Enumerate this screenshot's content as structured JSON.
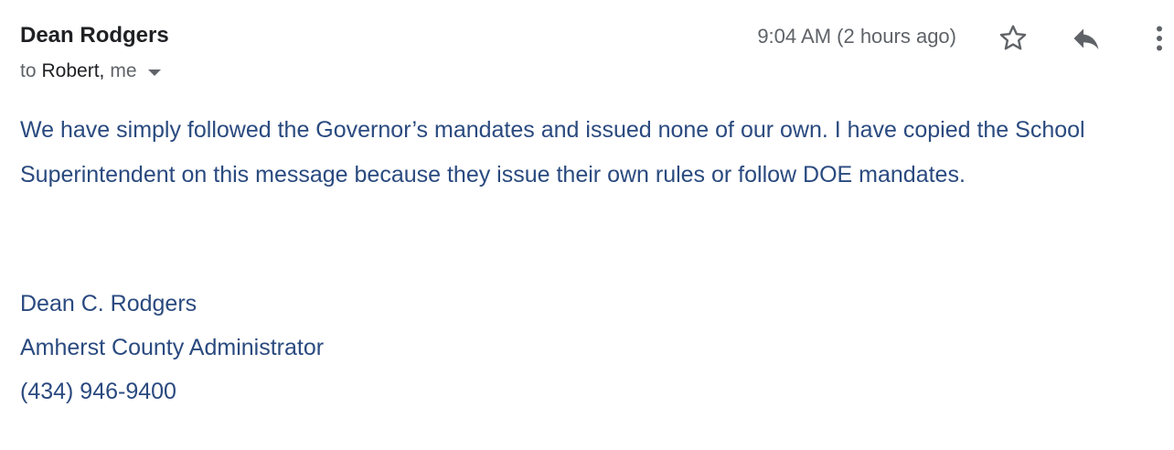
{
  "email": {
    "sender": "Dean Rodgers",
    "recipients": {
      "to_word": "to",
      "to_name": "Robert,",
      "to_me": "me"
    },
    "timestamp": "9:04 AM (2 hours ago)",
    "icons": {
      "star": "star-icon",
      "reply": "reply-icon",
      "more": "more-vertical-icon",
      "recipients_caret": "caret-down-icon"
    },
    "body": "We have simply followed the Governor’s mandates and issued none of our own.  I have copied the School Superintendent on this message because they issue their own rules or follow DOE mandates.",
    "signature": {
      "name": "Dean C. Rodgers",
      "title": "Amherst County Administrator",
      "phone": "(434) 946-9400"
    }
  },
  "colors": {
    "body_text": "#2a4a7f",
    "sender_text": "#202124",
    "meta_text": "#5f6368"
  }
}
